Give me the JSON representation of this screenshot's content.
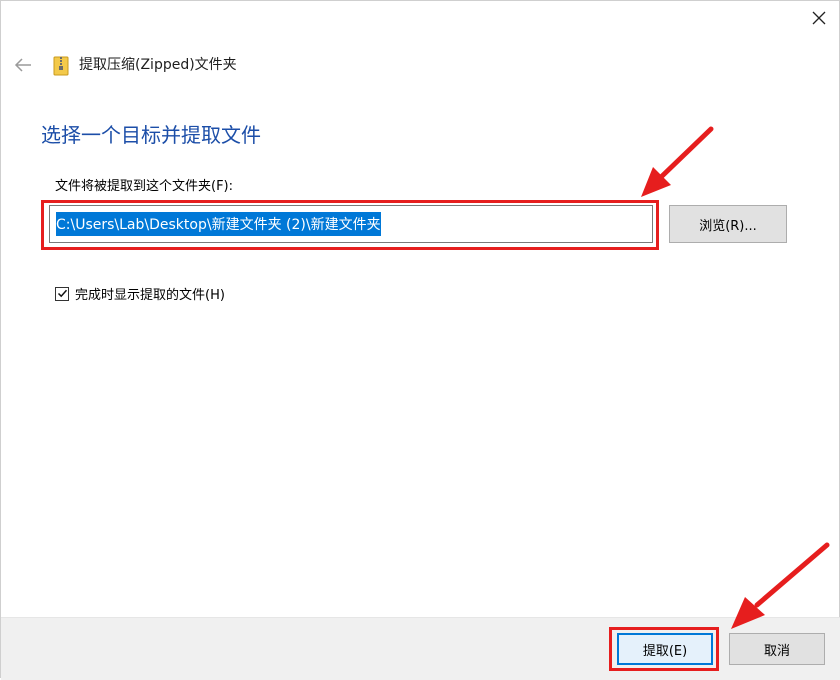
{
  "window": {
    "title": "提取压缩(Zipped)文件夹"
  },
  "content": {
    "heading": "选择一个目标并提取文件",
    "field_label": "文件将被提取到这个文件夹(F):",
    "path_value": "C:\\Users\\Lab\\Desktop\\新建文件夹 (2)\\新建文件夹",
    "browse_label": "浏览(R)...",
    "checkbox_label": "完成时显示提取的文件(H)",
    "checkbox_checked": true
  },
  "footer": {
    "extract_label": "提取(E)",
    "cancel_label": "取消"
  },
  "colors": {
    "heading": "#1c4ea8",
    "selection": "#0078d7",
    "annotation": "#e61e1e",
    "footer_bg": "#f0f0f0"
  },
  "icons": {
    "close": "close-icon",
    "back": "back-arrow-icon",
    "folder": "zip-folder-icon",
    "check": "checkmark-icon"
  }
}
